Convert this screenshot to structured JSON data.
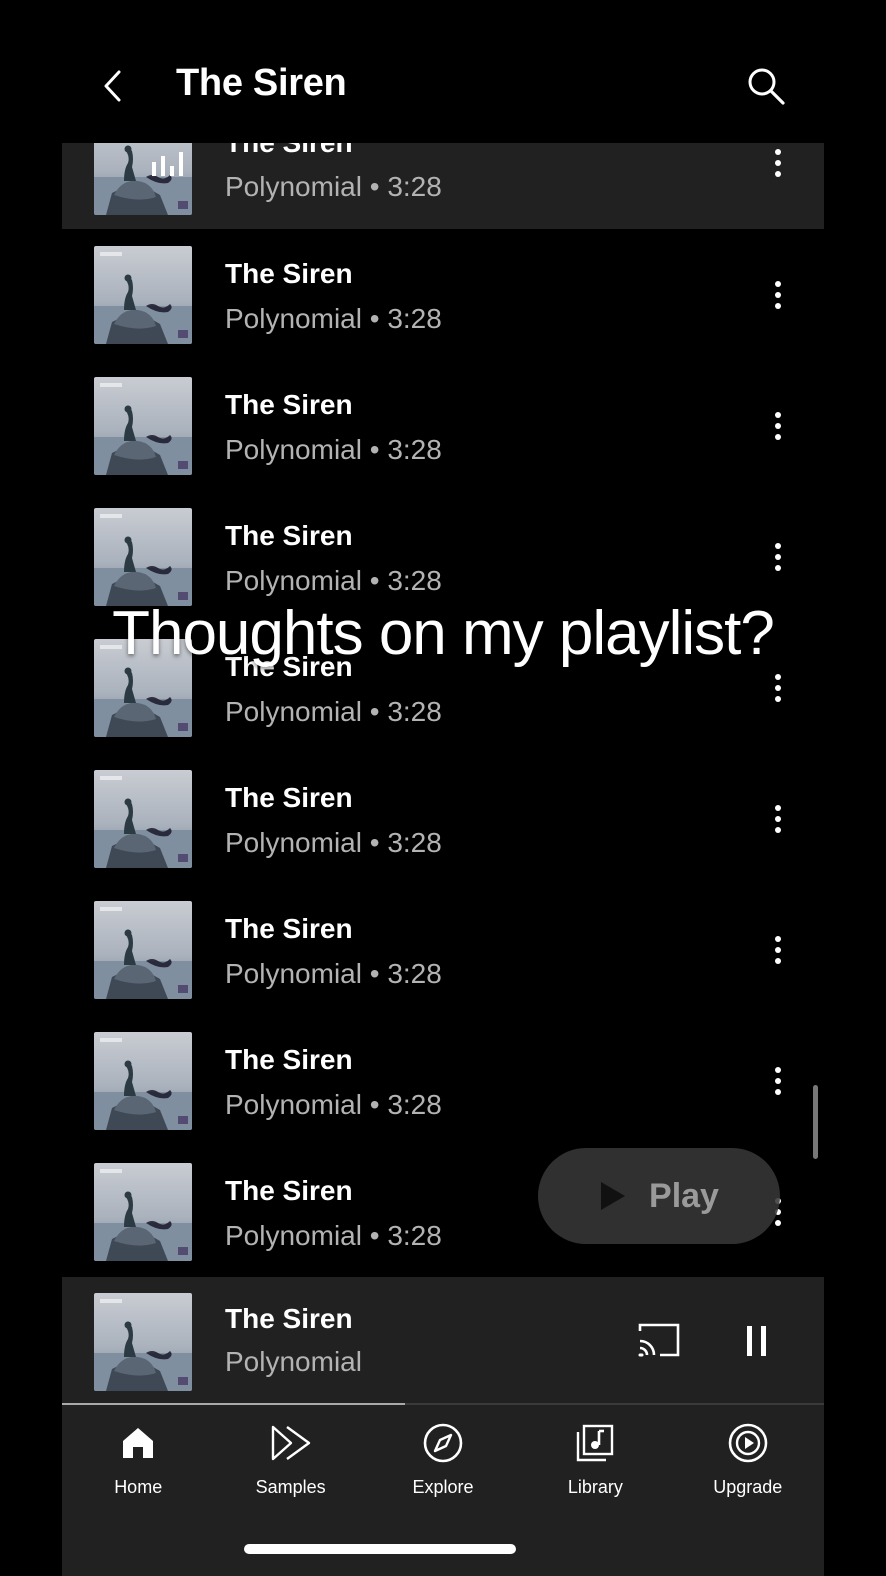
{
  "header": {
    "title": "The Siren"
  },
  "tracks": [
    {
      "title": "The Siren",
      "subtitle": "Polynomial • 3:28",
      "now_playing": true
    },
    {
      "title": "The Siren",
      "subtitle": "Polynomial • 3:28"
    },
    {
      "title": "The Siren",
      "subtitle": "Polynomial • 3:28"
    },
    {
      "title": "The Siren",
      "subtitle": "Polynomial • 3:28"
    },
    {
      "title": "The Siren",
      "subtitle": "Polynomial • 3:28"
    },
    {
      "title": "The Siren",
      "subtitle": "Polynomial • 3:28"
    },
    {
      "title": "The Siren",
      "subtitle": "Polynomial • 3:28"
    },
    {
      "title": "The Siren",
      "subtitle": "Polynomial • 3:28"
    },
    {
      "title": "The Siren",
      "subtitle": "Polynomial • 3:28"
    }
  ],
  "caption": "Thoughts on my playlist?",
  "play_button": {
    "label": "Play"
  },
  "mini_player": {
    "title": "The Siren",
    "artist": "Polynomial",
    "progress": 0.45
  },
  "nav": [
    {
      "label": "Home",
      "icon": "home-icon",
      "active": true
    },
    {
      "label": "Samples",
      "icon": "samples-icon"
    },
    {
      "label": "Explore",
      "icon": "compass-icon"
    },
    {
      "label": "Library",
      "icon": "library-icon"
    },
    {
      "label": "Upgrade",
      "icon": "upgrade-icon"
    }
  ],
  "colors": {
    "background": "#000000",
    "surface": "#212121",
    "secondary_text": "#b3b3b3"
  }
}
